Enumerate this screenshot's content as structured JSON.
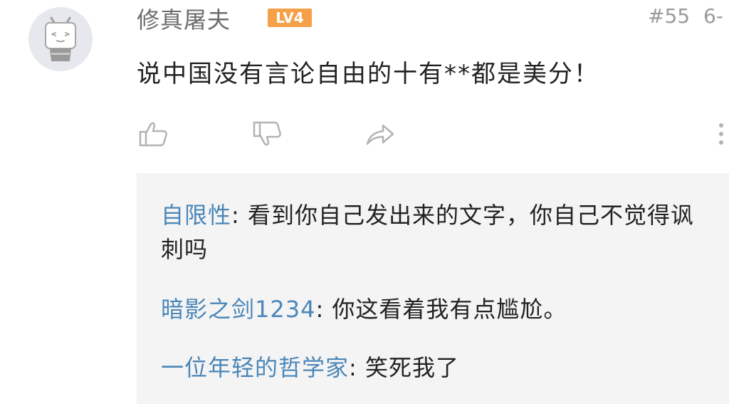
{
  "comment": {
    "username": "修真屠夫",
    "level_badge": "LV4",
    "floor": "#55",
    "date": "6-",
    "text": "说中国没有言论自由的十有**都是美分！"
  },
  "actions": {
    "like_icon": "thumb-up-icon",
    "dislike_icon": "thumb-down-icon",
    "share_icon": "share-icon",
    "more_icon": "more-vertical-icon"
  },
  "replies": [
    {
      "name": "自限性",
      "separator": ": ",
      "text": "看到你自己发出来的文字，你自己不觉得讽刺吗"
    },
    {
      "name": "暗影之剑1234",
      "separator": ": ",
      "text": "你这看着我有点尴尬。"
    },
    {
      "name": "一位年轻的哲学家",
      "separator": ": ",
      "text": "笑死我了"
    }
  ],
  "colors": {
    "username": "#6d6d6d",
    "badge": "#f5a14a",
    "reply_name": "#4b86b8",
    "reply_bg": "#f4f4f4",
    "icon": "#b3b3b3"
  }
}
